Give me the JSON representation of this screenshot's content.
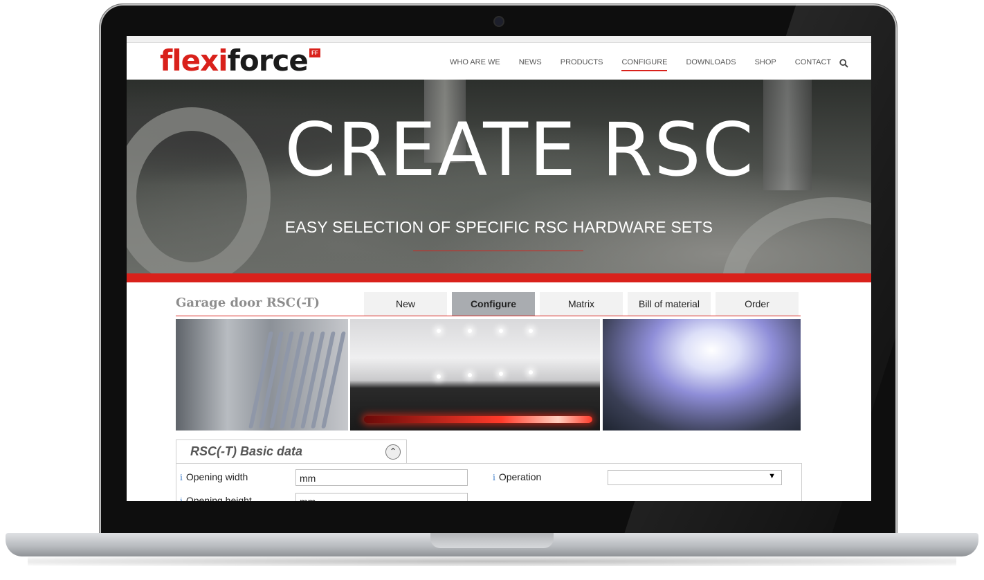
{
  "site": {
    "logo_part1": "flexi",
    "logo_part2": "force",
    "logo_badge": "FF"
  },
  "nav": {
    "items": [
      {
        "label": "WHO ARE WE"
      },
      {
        "label": "NEWS"
      },
      {
        "label": "PRODUCTS"
      },
      {
        "label": "CONFIGURE",
        "active": true
      },
      {
        "label": "DOWNLOADS"
      },
      {
        "label": "SHOP"
      },
      {
        "label": "CONTACT"
      }
    ],
    "search_icon": "search-icon"
  },
  "hero": {
    "title": "CREATE RSC",
    "subtitle": "EASY SELECTION OF SPECIFIC RSC HARDWARE SETS"
  },
  "configurator": {
    "product_title": "Garage door RSC(-T)",
    "tabs": [
      {
        "label": "New"
      },
      {
        "label": "Configure",
        "active": true
      },
      {
        "label": "Matrix"
      },
      {
        "label": "Bill of material"
      },
      {
        "label": "Order"
      }
    ]
  },
  "basic_data": {
    "title": "RSC(-T) Basic data",
    "collapse_icon": "chevron-up-icon",
    "fields": {
      "opening_width_label": "Opening width",
      "opening_width_value": "mm",
      "opening_height_label": "Opening height",
      "opening_height_value": "mm",
      "operation_label": "Operation",
      "operation_value": ""
    },
    "info_glyph": "i"
  },
  "colors": {
    "brand_red": "#d9211b",
    "active_tab": "#a9acb0"
  }
}
